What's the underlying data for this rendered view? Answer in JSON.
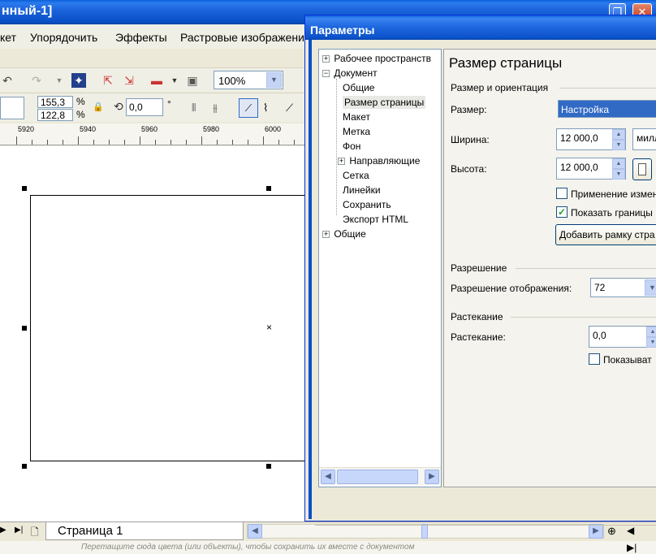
{
  "app": {
    "title_fragment": "нный-1]"
  },
  "menu": {
    "items": [
      "кет",
      "Упорядочить",
      "Эффекты",
      "Растровые изображени"
    ]
  },
  "toolbar": {
    "zoom_value": "100%",
    "width_percent": "155,3",
    "height_percent": "122,8",
    "percent_symbol": "%",
    "rotation_value": "0,0",
    "degree_symbol": "°"
  },
  "ruler": {
    "labels": [
      "5920",
      "5940",
      "5960",
      "5980",
      "6000"
    ]
  },
  "dialog": {
    "title": "Параметры",
    "tree": [
      {
        "label": "Рабочее пространств",
        "level": 0,
        "expander": "+"
      },
      {
        "label": "Документ",
        "level": 0,
        "expander": "−"
      },
      {
        "label": "Общие",
        "level": 1
      },
      {
        "label": "Размер страницы",
        "level": 1,
        "selected": true
      },
      {
        "label": "Макет",
        "level": 1
      },
      {
        "label": "Метка",
        "level": 1
      },
      {
        "label": "Фон",
        "level": 1
      },
      {
        "label": "Направляющие",
        "level": 1,
        "expander": "+"
      },
      {
        "label": "Сетка",
        "level": 1
      },
      {
        "label": "Линейки",
        "level": 1
      },
      {
        "label": "Сохранить",
        "level": 1
      },
      {
        "label": "Экспорт HTML",
        "level": 1
      },
      {
        "label": "Общие",
        "level": 0,
        "expander": "+"
      }
    ],
    "content": {
      "title": "Размер страницы",
      "group_size_orientation": "Размер и ориентация",
      "size_label": "Размер:",
      "size_value": "Настройка",
      "width_label": "Ширина:",
      "width_value": "12 000,0",
      "units_value": "милл",
      "height_label": "Высота:",
      "height_value": "12 000,0",
      "apply_changes_label": "Применение измен",
      "apply_changes_checked": false,
      "show_border_label": "Показать границы",
      "show_border_checked": true,
      "add_frame_button": "Добавить рамку стра",
      "group_resolution": "Разрешение",
      "display_resolution_label": "Разрешение отображения:",
      "display_resolution_value": "72",
      "group_bleed": "Растекание",
      "bleed_label": "Растекание:",
      "bleed_value": "0,0",
      "show_bleed_label": "Показыват",
      "show_bleed_checked": false
    }
  },
  "page_tabs": {
    "active_tab": "Страница 1"
  },
  "status": {
    "hint": "Перетащите сюда цвета (или объекты), чтобы сохранить их вместе с документом"
  }
}
